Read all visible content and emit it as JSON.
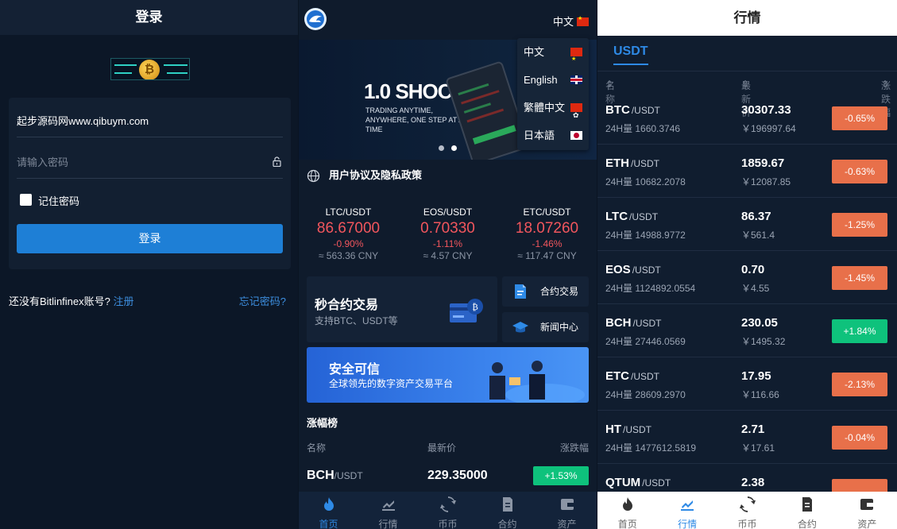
{
  "login": {
    "title": "登录",
    "username": "起步源码网www.qibuym.com",
    "password_placeholder": "请输入密码",
    "remember": "记住密码",
    "submit": "登录",
    "no_account": "还没有Bitlinfinex账号?",
    "register": "注册",
    "forgot": "忘记密码?"
  },
  "home": {
    "lang_current": "中文",
    "lang_menu": [
      "中文",
      "English",
      "繁體中文",
      "日本語"
    ],
    "banner": {
      "title": "1.0 SHOCK",
      "subtitle": "TRADING ANYTIME, ANYWHERE, ONE STEP AT A TIME"
    },
    "notice": "用户协议及隐私政策",
    "tickers": [
      {
        "name": "LTC/USDT",
        "price": "86.67000",
        "change": "-0.90%",
        "cny": "≈ 563.36 CNY"
      },
      {
        "name": "EOS/USDT",
        "price": "0.70330",
        "change": "-1.11%",
        "cny": "≈ 4.57 CNY"
      },
      {
        "name": "ETC/USDT",
        "price": "18.07260",
        "change": "-1.46%",
        "cny": "≈ 117.47 CNY"
      }
    ],
    "card_main": {
      "title": "秒合约交易",
      "subtitle": "支持BTC、USDT等"
    },
    "card_contract": "合约交易",
    "card_news": "新闻中心",
    "safe": {
      "title": "安全可信",
      "subtitle": "全球领先的数字资产交易平台"
    },
    "rank": {
      "title": "涨幅榜",
      "col_name": "名称",
      "col_price": "最新价",
      "col_change": "涨跌幅",
      "row": {
        "sym": "BCH",
        "quote": "/USDT",
        "price": "229.35000",
        "change": "+1.53%"
      }
    }
  },
  "tabs": [
    "首页",
    "行情",
    "币币",
    "合约",
    "资产"
  ],
  "market": {
    "title": "行情",
    "tab": "USDT",
    "col_name": "名称",
    "col_price": "最新价",
    "col_change": "涨跌幅",
    "rows": [
      {
        "sym": "BTC",
        "quote": "/USDT",
        "vol": "24H量 1660.3746",
        "price": "30307.33",
        "cny": "￥196997.64",
        "change": "-0.65%",
        "color": "#e8704a"
      },
      {
        "sym": "ETH",
        "quote": "/USDT",
        "vol": "24H量 10682.2078",
        "price": "1859.67",
        "cny": "￥12087.85",
        "change": "-0.63%",
        "color": "#e8704a"
      },
      {
        "sym": "LTC",
        "quote": "/USDT",
        "vol": "24H量 14988.9772",
        "price": "86.37",
        "cny": "￥561.4",
        "change": "-1.25%",
        "color": "#e8704a"
      },
      {
        "sym": "EOS",
        "quote": "/USDT",
        "vol": "24H量 1124892.0554",
        "price": "0.70",
        "cny": "￥4.55",
        "change": "-1.45%",
        "color": "#e8704a"
      },
      {
        "sym": "BCH",
        "quote": "/USDT",
        "vol": "24H量 27446.0569",
        "price": "230.05",
        "cny": "￥1495.32",
        "change": "+1.84%",
        "color": "#0ec27c"
      },
      {
        "sym": "ETC",
        "quote": "/USDT",
        "vol": "24H量 28609.2970",
        "price": "17.95",
        "cny": "￥116.66",
        "change": "-2.13%",
        "color": "#e8704a"
      },
      {
        "sym": "HT",
        "quote": "/USDT",
        "vol": "24H量 1477612.5819",
        "price": "2.71",
        "cny": "￥17.61",
        "change": "-0.04%",
        "color": "#e8704a"
      },
      {
        "sym": "QTUM",
        "quote": "/USDT",
        "vol": "",
        "price": "2.38",
        "cny": "",
        "change": "",
        "color": "#e8704a"
      }
    ]
  }
}
